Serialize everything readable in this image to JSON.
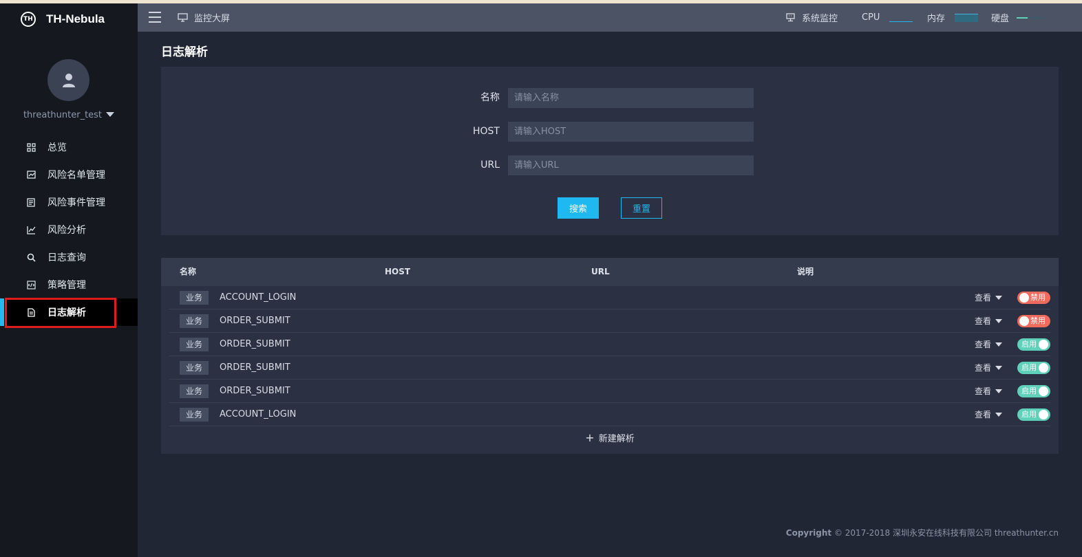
{
  "app": {
    "logo_mark": "TH",
    "name": "TH-Nebula"
  },
  "user": {
    "name": "threathunter_test"
  },
  "nav": [
    {
      "label": "总览",
      "icon": "grid-icon"
    },
    {
      "label": "风险名单管理",
      "icon": "list-edit-icon"
    },
    {
      "label": "风险事件管理",
      "icon": "document-icon"
    },
    {
      "label": "风险分析",
      "icon": "line-chart-icon"
    },
    {
      "label": "日志查询",
      "icon": "search-icon"
    },
    {
      "label": "策略管理",
      "icon": "code-icon"
    },
    {
      "label": "日志解析",
      "icon": "file-icon",
      "active": true
    }
  ],
  "header": {
    "monitor_screen": "监控大屏",
    "system_monitor": "系统监控",
    "cpu_label": "CPU",
    "memory_label": "内存",
    "disk_label": "硬盘"
  },
  "page": {
    "title": "日志解析"
  },
  "form": {
    "name_label": "名称",
    "name_placeholder": "请输入名称",
    "host_label": "HOST",
    "host_placeholder": "请输入HOST",
    "url_label": "URL",
    "url_placeholder": "请输入URL",
    "search_button": "搜索",
    "reset_button": "重置"
  },
  "table": {
    "columns": [
      "名称",
      "HOST",
      "URL",
      "说明"
    ],
    "rows": [
      {
        "tag": "业务",
        "name": "ACCOUNT_LOGIN",
        "view": "查看",
        "status": "禁用",
        "enabled": false
      },
      {
        "tag": "业务",
        "name": "ORDER_SUBMIT",
        "view": "查看",
        "status": "禁用",
        "enabled": false
      },
      {
        "tag": "业务",
        "name": "ORDER_SUBMIT",
        "view": "查看",
        "status": "启用",
        "enabled": true
      },
      {
        "tag": "业务",
        "name": "ORDER_SUBMIT",
        "view": "查看",
        "status": "启用",
        "enabled": true
      },
      {
        "tag": "业务",
        "name": "ORDER_SUBMIT",
        "view": "查看",
        "status": "启用",
        "enabled": true
      },
      {
        "tag": "业务",
        "name": "ACCOUNT_LOGIN",
        "view": "查看",
        "status": "启用",
        "enabled": true
      }
    ],
    "add_button": "新建解析"
  },
  "footer": {
    "copyright_label": "Copyright",
    "text": "© 2017-2018 深圳永安在线科技有限公司 threathunter.cn"
  },
  "colors": {
    "accent": "#1fb8f0",
    "danger": "#ef6b5e",
    "success": "#5fd0ba",
    "highlight_border": "#e01b1b"
  }
}
